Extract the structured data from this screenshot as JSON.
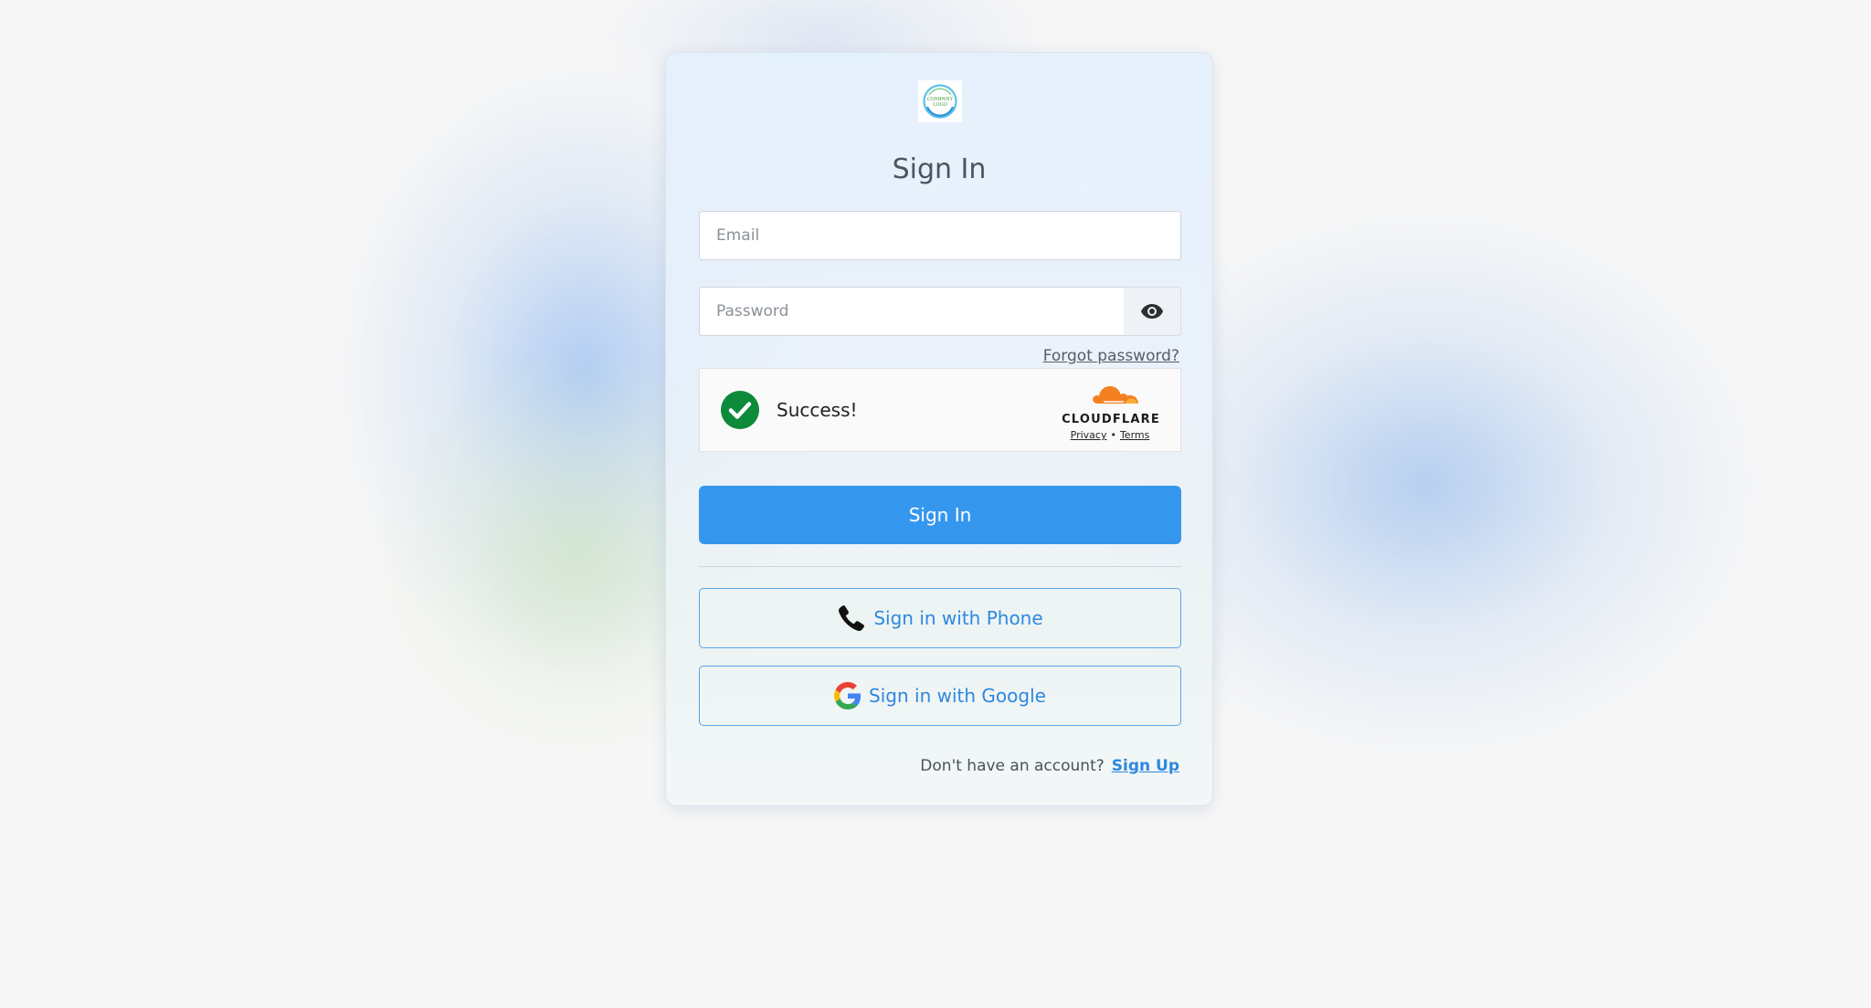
{
  "logo": {
    "text": "COMPANY LOGO"
  },
  "title": "Sign In",
  "email": {
    "placeholder": "Email",
    "value": ""
  },
  "password": {
    "placeholder": "Password",
    "value": "",
    "toggle_icon": "eye-icon"
  },
  "forgot_password": "Forgot password?",
  "captcha": {
    "status": "Success!",
    "status_icon": "check-circle-icon",
    "status_color": "#0d8a3a",
    "provider": "CLOUDFLARE",
    "privacy": "Privacy",
    "separator": "•",
    "terms": "Terms"
  },
  "sign_in_button": "Sign In",
  "phone_button": {
    "label": "Sign in with Phone",
    "icon": "phone-icon"
  },
  "google_button": {
    "label": "Sign in with Google",
    "icon": "google-icon"
  },
  "signup": {
    "prompt": "Don't have an account?",
    "link": "Sign Up"
  },
  "colors": {
    "primary": "#3596ee",
    "link": "#2e88df",
    "cloudflare_orange": "#f38020"
  }
}
